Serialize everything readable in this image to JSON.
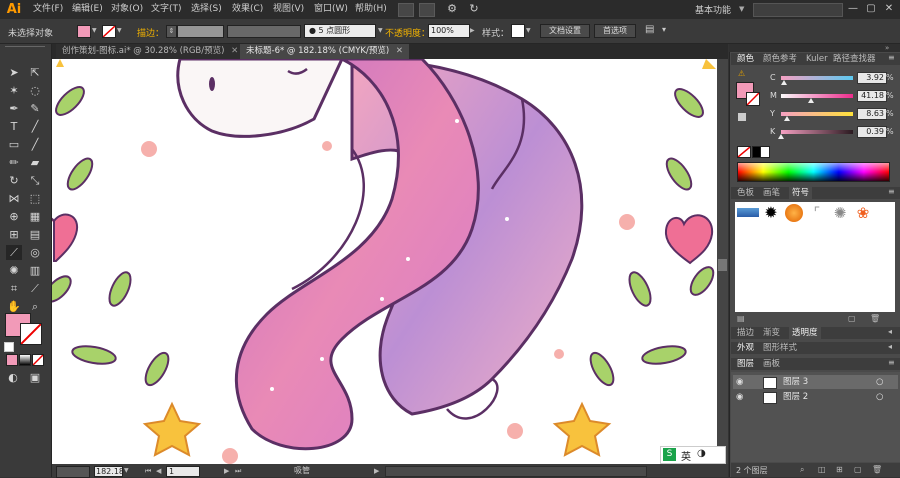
{
  "app": {
    "logo": "Ai"
  },
  "menubar": {
    "items": [
      "文件(F)",
      "编辑(E)",
      "对象(O)",
      "文字(T)",
      "选择(S)",
      "效果(C)",
      "视图(V)",
      "窗口(W)",
      "帮助(H)"
    ],
    "workspace": "基本功能",
    "window_buttons": [
      "—",
      "▢",
      "✕"
    ]
  },
  "controlbar": {
    "no_selection": "未选择对象",
    "stroke_label": "描边：",
    "brush_value": "5 点圆形",
    "opacity_label": "不透明度：",
    "opacity_value": "100%",
    "style_label": "样式：",
    "doc_setup": "文档设置",
    "preferences": "首选项",
    "fill_color": "#f29ab8"
  },
  "tabs": [
    {
      "label": "创作策划-图标.ai* @ 30.28% (RGB/预览)",
      "close": "✕"
    },
    {
      "label": "未标题-6* @ 182.18% (CMYK/预览)",
      "close": "✕"
    }
  ],
  "statusbar": {
    "zoom": "182.18",
    "page": "1",
    "tool": "吸管"
  },
  "color_panel": {
    "tabs": [
      "颜色",
      "颜色参考",
      "Kuler",
      "路径查找器"
    ],
    "channels": [
      {
        "label": "C",
        "value": "3.92",
        "unit": "%",
        "fraction": 0.04,
        "gradient": "linear-gradient(to right,#f5a0c2,#5cc9f0)"
      },
      {
        "label": "M",
        "value": "41.18",
        "unit": "%",
        "fraction": 0.41,
        "gradient": "linear-gradient(to right,#fafafa,#ed2c8c)"
      },
      {
        "label": "Y",
        "value": "8.63",
        "unit": "%",
        "fraction": 0.09,
        "gradient": "linear-gradient(to right,#f5a0c2,#ffe23a)"
      },
      {
        "label": "K",
        "value": "0.39",
        "unit": "%",
        "fraction": 0.0,
        "gradient": "linear-gradient(to right,#f5a0c2,#2a1a20)"
      }
    ]
  },
  "swatch_panel": {
    "tabs": [
      "色板",
      "画笔",
      "符号"
    ]
  },
  "transparency_panel": {
    "tabs": [
      "描边",
      "渐变",
      "透明度"
    ]
  },
  "appearance_panel": {
    "tabs": [
      "外观",
      "图形样式"
    ]
  },
  "layers_panel": {
    "tabs": [
      "图层",
      "画板"
    ],
    "layers": [
      {
        "name": "图层 3",
        "selected": true
      },
      {
        "name": "图层 2",
        "selected": false
      }
    ],
    "count": "2 个图层"
  },
  "ime": {
    "label": "英"
  }
}
